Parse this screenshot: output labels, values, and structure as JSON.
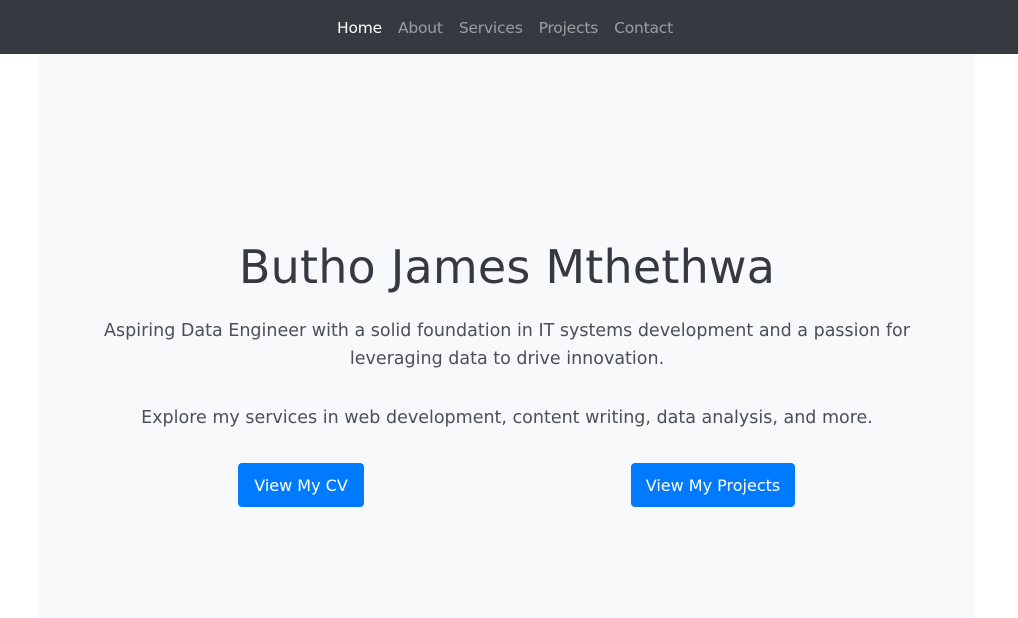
{
  "nav": {
    "items": [
      {
        "label": "Home",
        "active": true
      },
      {
        "label": "About",
        "active": false
      },
      {
        "label": "Services",
        "active": false
      },
      {
        "label": "Projects",
        "active": false
      },
      {
        "label": "Contact",
        "active": false
      }
    ]
  },
  "hero": {
    "title": "Butho James Mthethwa",
    "lead": "Aspiring Data Engineer with a solid foundation in IT systems development and a passion for leveraging data to drive innovation.",
    "sub": "Explore my services in web development, content writing, data analysis, and more.",
    "cv_button": "View My CV",
    "projects_button": "View My Projects"
  },
  "colors": {
    "navbar_bg": "#343a40",
    "hero_bg": "#f8f9fa",
    "accent": "#007bff"
  }
}
